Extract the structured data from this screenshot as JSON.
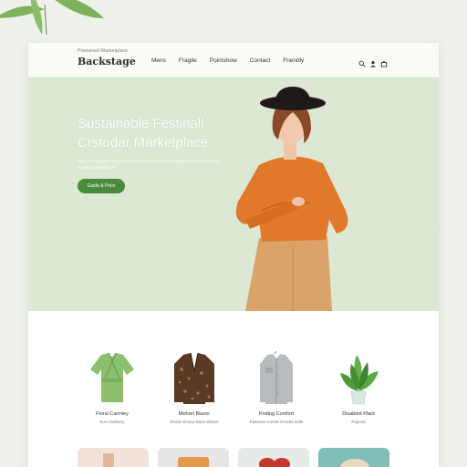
{
  "header": {
    "tagline": "Preowned Marketplace",
    "logo": "Backstage",
    "nav": [
      "Mens",
      "Fragile",
      "Pointshow",
      "Contact",
      "Friendly"
    ],
    "icons": [
      "search-icon",
      "user-icon",
      "cart-icon"
    ]
  },
  "hero": {
    "title_line1": "Sustainable Festinall",
    "title_line2": "Crstodar Marketplace",
    "subtitle": "Shop sustainable secondhand pieces and discover vintage treasures from our curated marketplace",
    "button": "Guide & Price",
    "background": "#dde8d4",
    "button_color": "#4a8a3c"
  },
  "products": [
    {
      "name": "Floral Carmley",
      "price": "Euro Delivery",
      "icon": "green-wrap-top"
    },
    {
      "name": "Mehret Blazer",
      "price": "Shrids Shuau Dacio Blazer",
      "icon": "leopard-blazer"
    },
    {
      "name": "Poding Comfort",
      "price": "Pastnew Carriet Ometta dolle",
      "icon": "grey-shirt"
    },
    {
      "name": "Disabled Plant",
      "price": "Popouk",
      "icon": "potted-plant"
    }
  ]
}
